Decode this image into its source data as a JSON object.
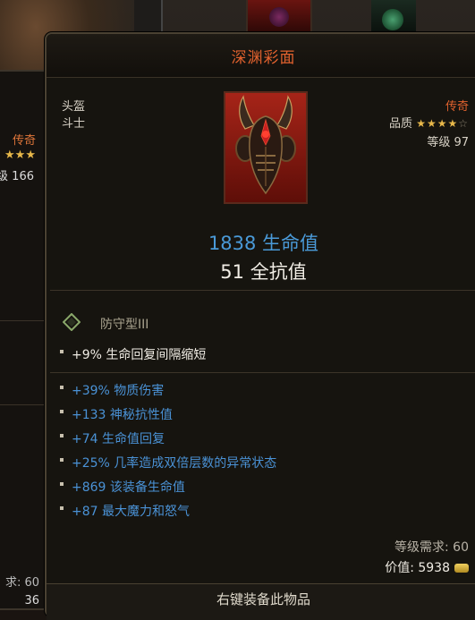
{
  "left_panel": {
    "rarity": "传奇",
    "stars": "★★★",
    "level_fragment": "级 166",
    "req_fragment": "求: 60",
    "price_fragment": "36"
  },
  "item": {
    "title": "深渊彩面",
    "slot": "头盔",
    "class": "斗士",
    "rarity": "传奇",
    "quality_label": "品质",
    "quality_stars_filled": "★★★★",
    "quality_stars_empty": "☆",
    "quality_value": 4,
    "quality_max": 5,
    "level": "等级 97",
    "main_stat": "1838 生命值",
    "secondary_stat": "51 全抗值"
  },
  "set": {
    "name": "防守型III"
  },
  "base_affixes": [
    "+9% 生命回复间隔缩短"
  ],
  "affixes": [
    "+39% 物质伤害",
    "+133 神秘抗性值",
    "+74 生命值回复",
    "+25% 几率造成双倍层数的异常状态",
    "+869 该装备生命值",
    "+87 最大魔力和怒气"
  ],
  "requirements": {
    "level_req": "等级需求: 60",
    "price": "价值: 5938"
  },
  "footer": {
    "action": "右键装备此物品"
  },
  "colors": {
    "rarity": "#e0622e",
    "affix_blue": "#4a92d6",
    "stars": "#e8b84a"
  }
}
